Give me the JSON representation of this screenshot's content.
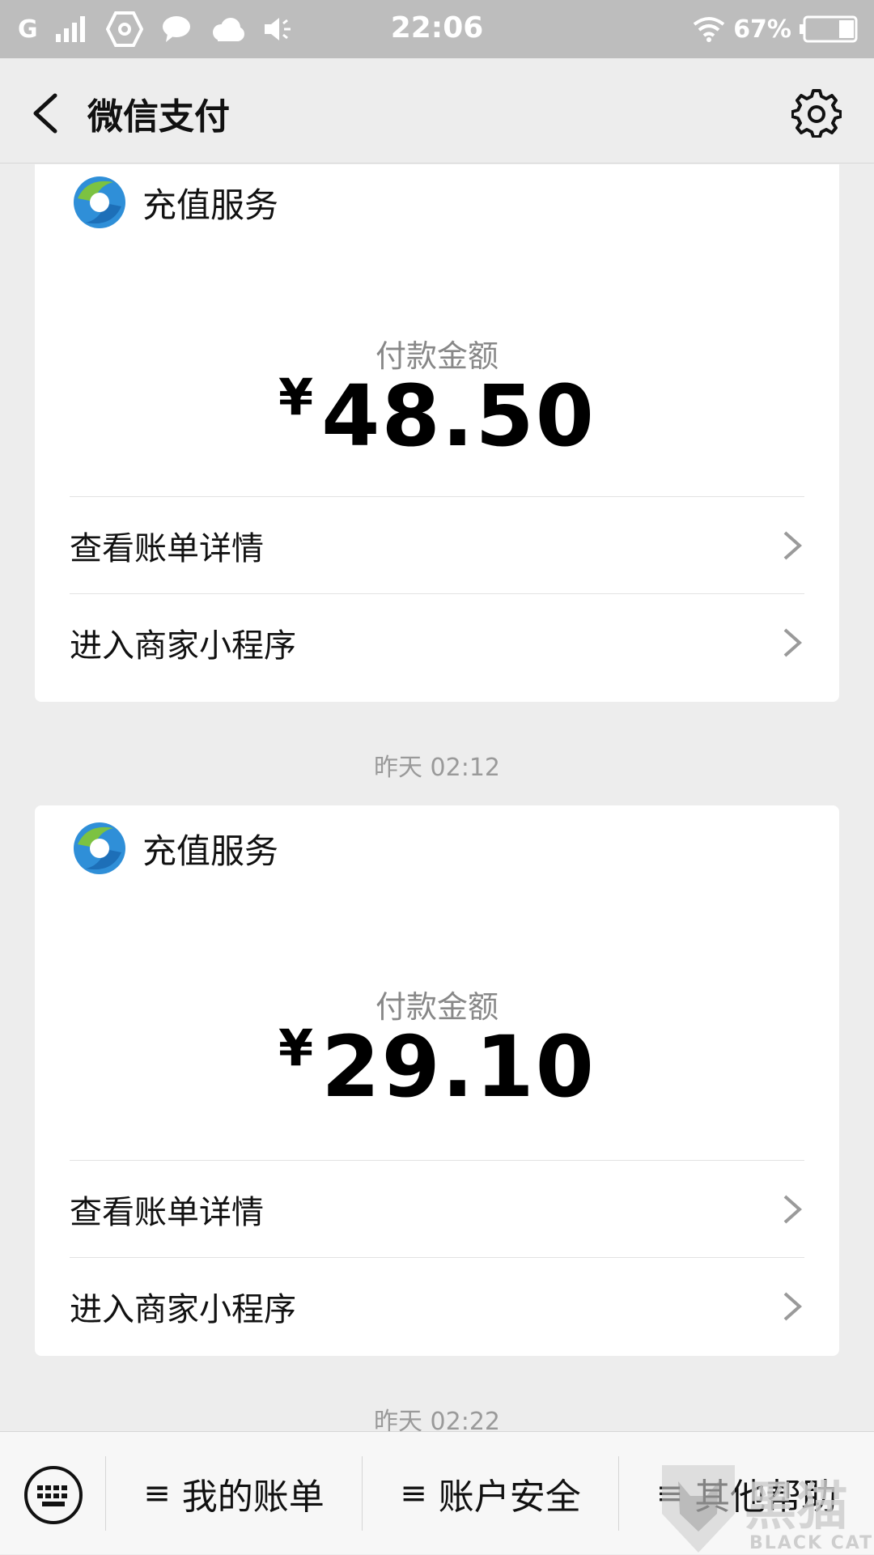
{
  "status_bar": {
    "network": "G",
    "time": "22:06",
    "battery": "67%"
  },
  "nav": {
    "title": "微信支付"
  },
  "payments": [
    {
      "merchant": "充值服务",
      "amount_label": "付款金额",
      "currency": "¥",
      "amount": "48.50",
      "actions": [
        "查看账单详情",
        "进入商家小程序"
      ]
    },
    {
      "merchant": "充值服务",
      "amount_label": "付款金额",
      "currency": "¥",
      "amount": "29.10",
      "actions": [
        "查看账单详情",
        "进入商家小程序"
      ]
    }
  ],
  "timestamps": [
    "昨天 02:12",
    "昨天 02:22"
  ],
  "bottom_menu": {
    "items": [
      "我的账单",
      "账户安全",
      "其他帮助"
    ],
    "menu_glyph": "≡"
  },
  "watermark": {
    "text": "BLACK CAT",
    "logo_text": "黑猫"
  },
  "colors": {
    "status_bar_bg": "#bdbdbd",
    "page_bg": "#ededed",
    "card_bg": "#ffffff",
    "muted_text": "#888888"
  }
}
